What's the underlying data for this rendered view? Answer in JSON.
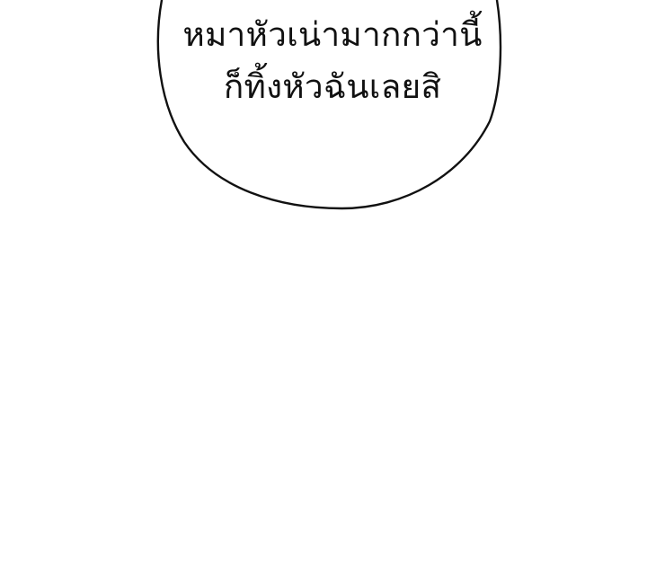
{
  "speech_bubble": {
    "lines": [
      "หมาหัวเน่ามากกว่านี้",
      "ก็ทิ้งหัวฉันเลยสิ"
    ]
  },
  "colors": {
    "background": "#ffffff",
    "ink": "#111111"
  }
}
